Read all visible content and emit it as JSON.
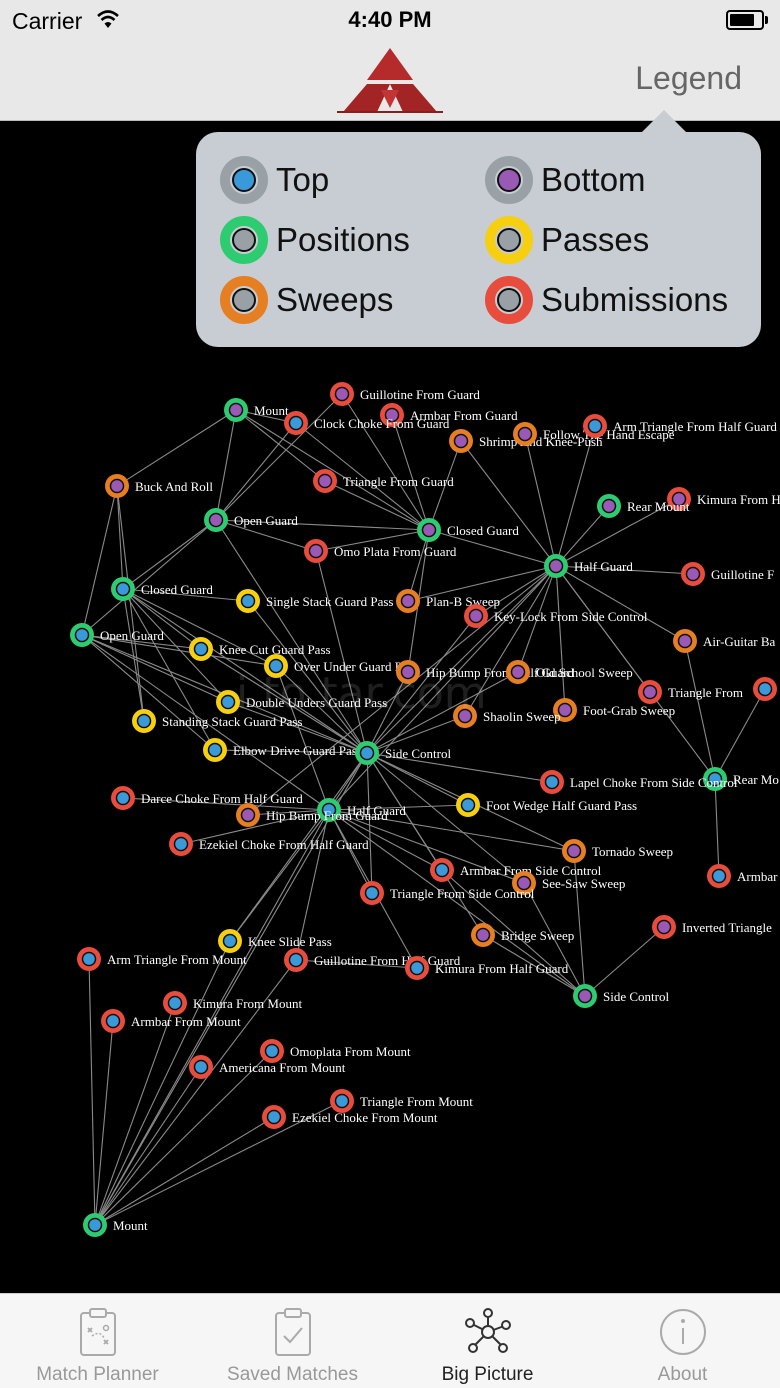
{
  "status_bar": {
    "carrier": "Carrier",
    "time": "4:40 PM"
  },
  "nav": {
    "legend_label": "Legend"
  },
  "colors": {
    "top": "#3a9ad9",
    "bottom": "#9b59b6",
    "positions": "#2ecc71",
    "passes": "#f5cf10",
    "sweeps": "#e67e22",
    "submissions": "#e74c3c",
    "neutral": "#9aa1a6",
    "edge": "#8a8a8a"
  },
  "legend": {
    "items": [
      {
        "label": "Top",
        "ring": "neutral",
        "core": "top"
      },
      {
        "label": "Bottom",
        "ring": "neutral",
        "core": "bottom"
      },
      {
        "label": "Positions",
        "ring": "positions",
        "core": "neutral"
      },
      {
        "label": "Passes",
        "ring": "passes",
        "core": "neutral"
      },
      {
        "label": "Sweeps",
        "ring": "sweeps",
        "core": "neutral"
      },
      {
        "label": "Submissions",
        "ring": "submissions",
        "core": "neutral"
      }
    ]
  },
  "watermark": "i    to    tar.com",
  "graph": {
    "nodes": [
      {
        "id": "mount_b",
        "label": "Mount",
        "ring": "positions",
        "core": "bottom"
      },
      {
        "id": "guillotine_guard",
        "label": "Guillotine From Guard",
        "ring": "submissions",
        "core": "bottom"
      },
      {
        "id": "armbar_guard",
        "label": "Armbar From Guard",
        "ring": "submissions",
        "core": "bottom"
      },
      {
        "id": "clock_choke",
        "label": "Clock Choke From Guard",
        "ring": "submissions",
        "core": "top"
      },
      {
        "id": "shrimp",
        "label": "Shrimp And Knee-Push",
        "ring": "sweeps",
        "core": "bottom"
      },
      {
        "id": "follow_hand",
        "label": "Follow The Hand Escape",
        "ring": "sweeps",
        "core": "bottom"
      },
      {
        "id": "arm_tri_half",
        "label": "Arm Triangle From Half Guard",
        "ring": "submissions",
        "core": "top"
      },
      {
        "id": "buck_roll",
        "label": "Buck And Roll",
        "ring": "sweeps",
        "core": "bottom"
      },
      {
        "id": "tri_guard",
        "label": "Triangle From Guard",
        "ring": "submissions",
        "core": "bottom"
      },
      {
        "id": "kimura_from",
        "label": "Kimura From H",
        "ring": "submissions",
        "core": "bottom"
      },
      {
        "id": "rear_mount_b",
        "label": "Rear Mount",
        "ring": "positions",
        "core": "bottom"
      },
      {
        "id": "open_guard_b",
        "label": "Open Guard",
        "ring": "positions",
        "core": "bottom"
      },
      {
        "id": "closed_guard_b",
        "label": "Closed Guard",
        "ring": "positions",
        "core": "bottom"
      },
      {
        "id": "omoplata_guard",
        "label": "Omo Plata From Guard",
        "ring": "submissions",
        "core": "bottom"
      },
      {
        "id": "half_guard_b",
        "label": "Half Guard",
        "ring": "positions",
        "core": "bottom"
      },
      {
        "id": "guillotine_f",
        "label": "Guillotine F",
        "ring": "submissions",
        "core": "bottom"
      },
      {
        "id": "closed_guard_t",
        "label": "Closed Guard",
        "ring": "positions",
        "core": "top"
      },
      {
        "id": "single_stack",
        "label": "Single Stack Guard Pass",
        "ring": "passes",
        "core": "top"
      },
      {
        "id": "plan_b",
        "label": "Plan-B Sweep",
        "ring": "sweeps",
        "core": "bottom"
      },
      {
        "id": "key_lock",
        "label": "Key-Lock From Side Control",
        "ring": "submissions",
        "core": "bottom"
      },
      {
        "id": "open_guard_t",
        "label": "Open Guard",
        "ring": "positions",
        "core": "top"
      },
      {
        "id": "knee_cut",
        "label": "Knee Cut Guard Pass",
        "ring": "passes",
        "core": "top"
      },
      {
        "id": "air_guitar",
        "label": "Air-Guitar Ba",
        "ring": "sweeps",
        "core": "bottom"
      },
      {
        "id": "over_under",
        "label": "Over Under Guard Pass",
        "ring": "passes",
        "core": "top"
      },
      {
        "id": "hip_bump_half",
        "label": "Hip Bump From Half Guard",
        "ring": "sweeps",
        "core": "bottom"
      },
      {
        "id": "old_school",
        "label": "Old School Sweep",
        "ring": "sweeps",
        "core": "bottom"
      },
      {
        "id": "tri_from",
        "label": "Triangle From",
        "ring": "submissions",
        "core": "bottom"
      },
      {
        "id": "far_right_sub",
        "label": "",
        "ring": "submissions",
        "core": "top"
      },
      {
        "id": "double_unders",
        "label": "Double Unders Guard Pass",
        "ring": "passes",
        "core": "top"
      },
      {
        "id": "foot_grab",
        "label": "Foot-Grab Sweep",
        "ring": "sweeps",
        "core": "bottom"
      },
      {
        "id": "standing_stack",
        "label": "Standing Stack Guard Pass",
        "ring": "passes",
        "core": "top"
      },
      {
        "id": "shaolin",
        "label": "Shaolin Sweep",
        "ring": "sweeps",
        "core": "bottom"
      },
      {
        "id": "elbow_drive",
        "label": "Elbow Drive Guard Pass",
        "ring": "passes",
        "core": "top"
      },
      {
        "id": "side_control_t",
        "label": "Side Control",
        "ring": "positions",
        "core": "top"
      },
      {
        "id": "rear_mount_t",
        "label": "Rear Mo",
        "ring": "positions",
        "core": "top"
      },
      {
        "id": "lapel_choke",
        "label": "Lapel Choke From Side Control",
        "ring": "submissions",
        "core": "top"
      },
      {
        "id": "darce",
        "label": "Darce Choke From Half Guard",
        "ring": "submissions",
        "core": "top"
      },
      {
        "id": "half_guard_t",
        "label": "Half Guard",
        "ring": "positions",
        "core": "top"
      },
      {
        "id": "hip_bump_guard",
        "label": "Hip Bump From Guard",
        "ring": "sweeps",
        "core": "bottom"
      },
      {
        "id": "foot_wedge",
        "label": "Foot Wedge Half Guard Pass",
        "ring": "passes",
        "core": "top"
      },
      {
        "id": "ezekiel_half",
        "label": "Ezekiel Choke From Half Guard",
        "ring": "submissions",
        "core": "top"
      },
      {
        "id": "tornado",
        "label": "Tornado Sweep",
        "ring": "sweeps",
        "core": "bottom"
      },
      {
        "id": "armbar_right",
        "label": "Armbar",
        "ring": "submissions",
        "core": "top"
      },
      {
        "id": "armbar_side",
        "label": "Armbar From Side Control",
        "ring": "submissions",
        "core": "top"
      },
      {
        "id": "see_saw",
        "label": "See-Saw Sweep",
        "ring": "sweeps",
        "core": "bottom"
      },
      {
        "id": "tri_side",
        "label": "Triangle From Side Control",
        "ring": "submissions",
        "core": "top"
      },
      {
        "id": "inverted_tri",
        "label": "Inverted Triangle",
        "ring": "submissions",
        "core": "bottom"
      },
      {
        "id": "bridge",
        "label": "Bridge Sweep",
        "ring": "sweeps",
        "core": "bottom"
      },
      {
        "id": "knee_slide",
        "label": "Knee Slide Pass",
        "ring": "passes",
        "core": "top"
      },
      {
        "id": "arm_tri_mount",
        "label": "Arm Triangle From Mount",
        "ring": "submissions",
        "core": "top"
      },
      {
        "id": "guillotine_half",
        "label": "Guillotine From Half Guard",
        "ring": "submissions",
        "core": "top"
      },
      {
        "id": "kimura_half",
        "label": "Kimura From Half Guard",
        "ring": "submissions",
        "core": "top"
      },
      {
        "id": "side_control_b",
        "label": "Side Control",
        "ring": "positions",
        "core": "bottom"
      },
      {
        "id": "kimura_mount",
        "label": "Kimura From Mount",
        "ring": "submissions",
        "core": "top"
      },
      {
        "id": "armbar_mount",
        "label": "Armbar From Mount",
        "ring": "submissions",
        "core": "top"
      },
      {
        "id": "omoplata_mount",
        "label": "Omoplata From Mount",
        "ring": "submissions",
        "core": "top"
      },
      {
        "id": "americana_mount",
        "label": "Americana From Mount",
        "ring": "submissions",
        "core": "top"
      },
      {
        "id": "tri_mount",
        "label": "Triangle From Mount",
        "ring": "submissions",
        "core": "top"
      },
      {
        "id": "ezekiel_mount",
        "label": "Ezekiel Choke From Mount",
        "ring": "submissions",
        "core": "top"
      },
      {
        "id": "mount_t",
        "label": "Mount",
        "ring": "positions",
        "core": "top"
      }
    ],
    "edges": [
      [
        "mount_b",
        "clock_choke"
      ],
      [
        "mount_b",
        "open_guard_b"
      ],
      [
        "mount_b",
        "buck_roll"
      ],
      [
        "mount_b",
        "tri_guard"
      ],
      [
        "mount_b",
        "closed_guard_b"
      ],
      [
        "open_guard_b",
        "guillotine_guard"
      ],
      [
        "open_guard_b",
        "clock_choke"
      ],
      [
        "open_guard_b",
        "closed_guard_t"
      ],
      [
        "open_guard_b",
        "open_guard_t"
      ],
      [
        "open_guard_b",
        "omoplata_guard"
      ],
      [
        "open_guard_b",
        "closed_guard_b"
      ],
      [
        "open_guard_b",
        "side_control_t"
      ],
      [
        "closed_guard_b",
        "guillotine_guard"
      ],
      [
        "closed_guard_b",
        "armbar_guard"
      ],
      [
        "closed_guard_b",
        "clock_choke"
      ],
      [
        "closed_guard_b",
        "tri_guard"
      ],
      [
        "closed_guard_b",
        "omoplata_guard"
      ],
      [
        "closed_guard_b",
        "shrimp"
      ],
      [
        "closed_guard_b",
        "half_guard_b"
      ],
      [
        "closed_guard_b",
        "plan_b"
      ],
      [
        "closed_guard_b",
        "hip_bump_half"
      ],
      [
        "buck_roll",
        "open_guard_t"
      ],
      [
        "buck_roll",
        "standing_stack"
      ],
      [
        "buck_roll",
        "closed_guard_t"
      ],
      [
        "half_guard_b",
        "follow_hand"
      ],
      [
        "half_guard_b",
        "arm_tri_half"
      ],
      [
        "half_guard_b",
        "rear_mount_b"
      ],
      [
        "half_guard_b",
        "kimura_from"
      ],
      [
        "half_guard_b",
        "guillotine_f"
      ],
      [
        "half_guard_b",
        "air_guitar"
      ],
      [
        "half_guard_b",
        "old_school"
      ],
      [
        "half_guard_b",
        "shrimp"
      ],
      [
        "half_guard_b",
        "key_lock"
      ],
      [
        "half_guard_b",
        "plan_b"
      ],
      [
        "half_guard_b",
        "hip_bump_guard"
      ],
      [
        "half_guard_b",
        "shaolin"
      ],
      [
        "half_guard_b",
        "foot_grab"
      ],
      [
        "half_guard_b",
        "side_control_t"
      ],
      [
        "half_guard_b",
        "half_guard_t"
      ],
      [
        "closed_guard_t",
        "single_stack"
      ],
      [
        "closed_guard_t",
        "knee_cut"
      ],
      [
        "closed_guard_t",
        "elbow_drive"
      ],
      [
        "closed_guard_t",
        "standing_stack"
      ],
      [
        "closed_guard_t",
        "double_unders"
      ],
      [
        "closed_guard_t",
        "side_control_t"
      ],
      [
        "closed_guard_t",
        "over_under"
      ],
      [
        "open_guard_t",
        "knee_cut"
      ],
      [
        "open_guard_t",
        "over_under"
      ],
      [
        "open_guard_t",
        "elbow_drive"
      ],
      [
        "open_guard_t",
        "side_control_t"
      ],
      [
        "open_guard_t",
        "half_guard_t"
      ],
      [
        "open_guard_t",
        "double_unders"
      ],
      [
        "side_control_t",
        "key_lock"
      ],
      [
        "side_control_t",
        "hip_bump_half"
      ],
      [
        "side_control_t",
        "old_school"
      ],
      [
        "side_control_t",
        "shaolin"
      ],
      [
        "side_control_t",
        "lapel_choke"
      ],
      [
        "side_control_t",
        "armbar_side"
      ],
      [
        "side_control_t",
        "tri_side"
      ],
      [
        "side_control_t",
        "elbow_drive"
      ],
      [
        "side_control_t",
        "foot_wedge"
      ],
      [
        "side_control_t",
        "tornado"
      ],
      [
        "side_control_t",
        "see_saw"
      ],
      [
        "side_control_t",
        "bridge"
      ],
      [
        "side_control_t",
        "mount_t"
      ],
      [
        "side_control_t",
        "double_unders"
      ],
      [
        "side_control_t",
        "knee_cut"
      ],
      [
        "side_control_t",
        "single_stack"
      ],
      [
        "side_control_t",
        "half_guard_t"
      ],
      [
        "side_control_t",
        "knee_slide"
      ],
      [
        "side_control_t",
        "over_under"
      ],
      [
        "side_control_t",
        "omoplata_guard"
      ],
      [
        "half_guard_t",
        "darce"
      ],
      [
        "half_guard_t",
        "ezekiel_half"
      ],
      [
        "half_guard_t",
        "foot_wedge"
      ],
      [
        "half_guard_t",
        "hip_bump_guard"
      ],
      [
        "half_guard_t",
        "guillotine_half"
      ],
      [
        "half_guard_t",
        "kimura_half"
      ],
      [
        "half_guard_t",
        "knee_slide"
      ],
      [
        "half_guard_t",
        "mount_t"
      ],
      [
        "half_guard_t",
        "side_control_b"
      ],
      [
        "half_guard_t",
        "tornado"
      ],
      [
        "half_guard_t",
        "see_saw"
      ],
      [
        "half_guard_t",
        "over_under"
      ],
      [
        "half_guard_t",
        "armbar_side"
      ],
      [
        "half_guard_t",
        "tri_side"
      ],
      [
        "side_control_b",
        "inverted_tri"
      ],
      [
        "side_control_b",
        "bridge"
      ],
      [
        "side_control_b",
        "see_saw"
      ],
      [
        "side_control_b",
        "tornado"
      ],
      [
        "side_control_b",
        "armbar_side"
      ],
      [
        "rear_mount_t",
        "far_right_sub"
      ],
      [
        "rear_mount_t",
        "armbar_right"
      ],
      [
        "rear_mount_t",
        "air_guitar"
      ],
      [
        "rear_mount_t",
        "half_guard_b"
      ],
      [
        "mount_t",
        "arm_tri_mount"
      ],
      [
        "mount_t",
        "kimura_mount"
      ],
      [
        "mount_t",
        "armbar_mount"
      ],
      [
        "mount_t",
        "americana_mount"
      ],
      [
        "mount_t",
        "omoplata_mount"
      ],
      [
        "mount_t",
        "tri_mount"
      ],
      [
        "mount_t",
        "ezekiel_mount"
      ],
      [
        "mount_t",
        "knee_slide"
      ],
      [
        "mount_t",
        "guillotine_half"
      ],
      [
        "tri_from",
        "half_guard_b"
      ],
      [
        "kimura_half",
        "guillotine_half"
      ]
    ]
  }
}
